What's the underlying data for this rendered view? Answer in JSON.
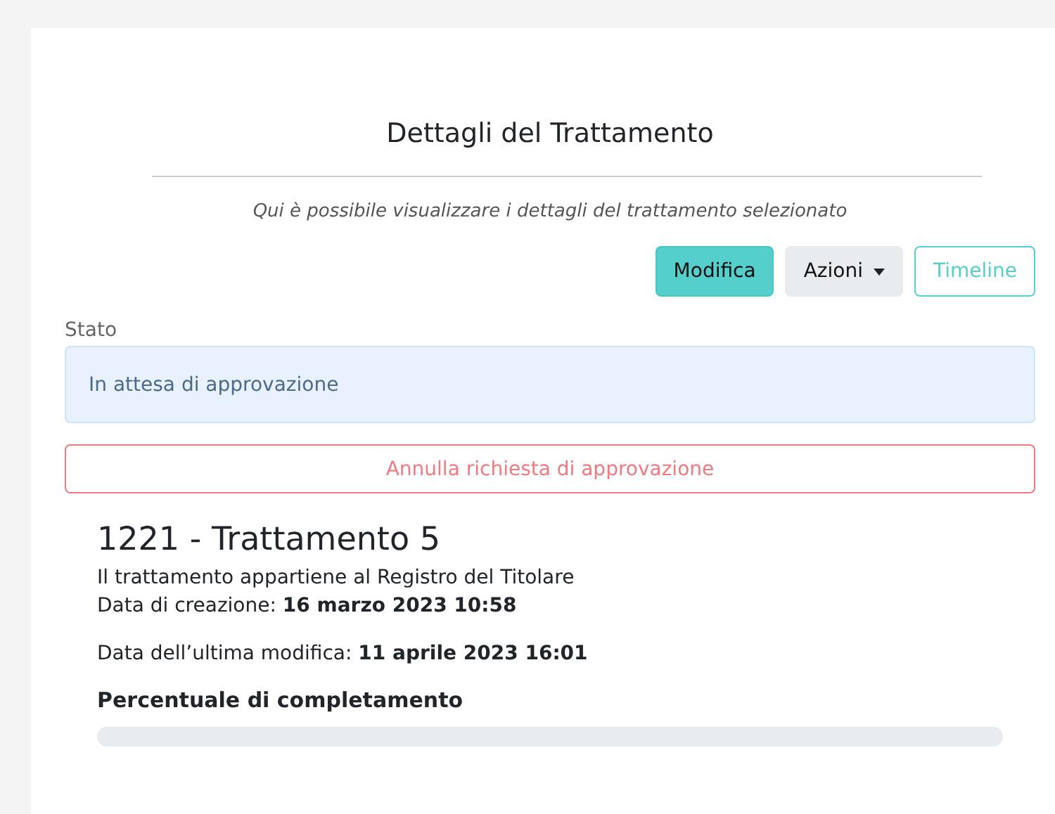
{
  "header": {
    "title": "Dettagli del Trattamento",
    "subtitle": "Qui è possibile visualizzare i dettagli del trattamento selezionato"
  },
  "actions": [
    {
      "kind": "primary",
      "label": "Modifica"
    },
    {
      "kind": "dropdown",
      "label": "Azioni"
    },
    {
      "kind": "outline",
      "label": "Timeline"
    }
  ],
  "status": {
    "label": "Stato",
    "value": "In attesa di approvazione"
  },
  "cancel_button": "Annulla richiesta di approvazione",
  "details": {
    "title": "1221 - Trattamento 5",
    "registry": "Il trattamento appartiene al Registro del Titolare",
    "created": {
      "label": "Data di creazione:",
      "value": "16 marzo 2023 10:58"
    },
    "modified": {
      "label": "Data dell’ultima modifica:",
      "value": "11 aprile 2023 16:01"
    },
    "progress": {
      "label": "Percentuale di completamento",
      "level": 0
    }
  }
}
